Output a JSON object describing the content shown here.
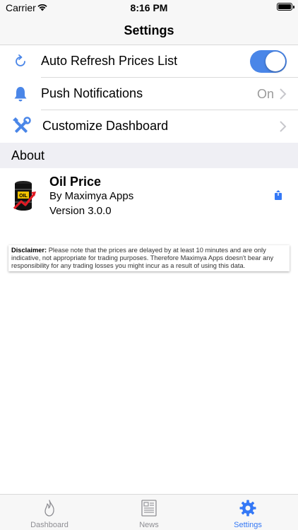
{
  "status_bar": {
    "carrier": "Carrier",
    "time": "8:16 PM"
  },
  "nav": {
    "title": "Settings"
  },
  "settings": {
    "auto_refresh": {
      "label": "Auto Refresh Prices List",
      "enabled": true,
      "icon": "refresh-icon"
    },
    "push_notifications": {
      "label": "Push Notifications",
      "value": "On",
      "icon": "bell-icon"
    },
    "customize_dashboard": {
      "label": "Customize Dashboard",
      "icon": "tools-icon"
    }
  },
  "about": {
    "header": "About",
    "app_name": "Oil Price",
    "developer": "By Maximya Apps",
    "version": "Version 3.0.0",
    "logo_text": "OIL"
  },
  "disclaimer": {
    "title": "Disclaimer:",
    "text": " Please note that the prices are delayed by at least 10 minutes and are only indicative, not appropriate for trading purposes. Therefore Maximya Apps doesn't bear any responsibility for any trading losses you might incur as a result of using this data."
  },
  "tabs": [
    {
      "label": "Dashboard",
      "icon": "flame-icon",
      "active": false
    },
    {
      "label": "News",
      "icon": "newspaper-icon",
      "active": false
    },
    {
      "label": "Settings",
      "icon": "gear-icon",
      "active": true
    }
  ],
  "colors": {
    "accent": "#3478f6",
    "toggle_on": "#4a86e8",
    "section_bg": "#efeff4"
  }
}
